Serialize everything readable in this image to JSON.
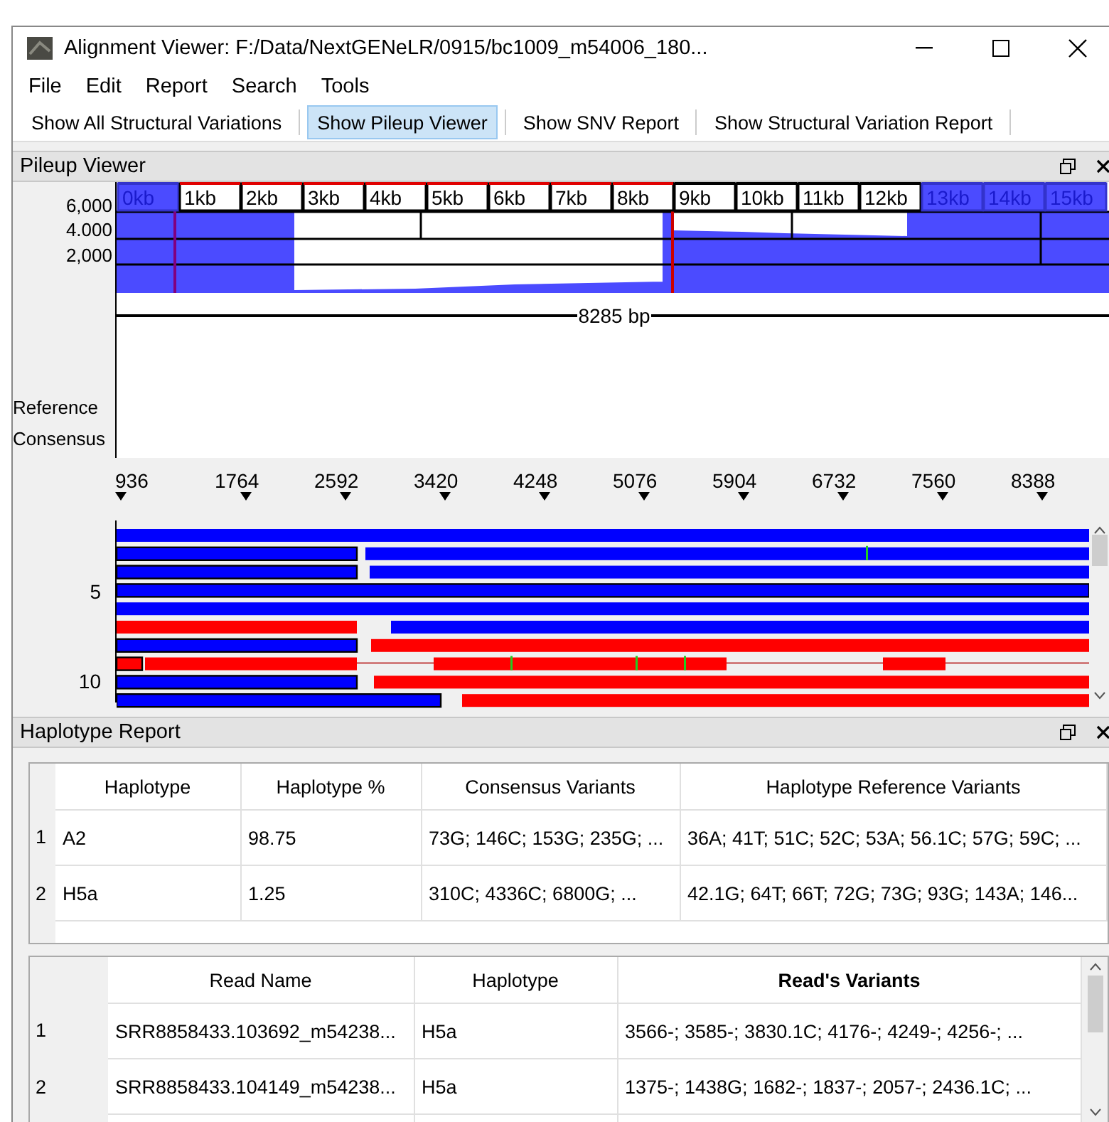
{
  "window": {
    "title": "Alignment Viewer: F:/Data/NextGENeLR/0915/bc1009_m54006_180..."
  },
  "menu": [
    "File",
    "Edit",
    "Report",
    "Search",
    "Tools"
  ],
  "toolbar": [
    {
      "label": "Show All Structural Variations",
      "selected": false
    },
    {
      "label": "Show Pileup Viewer",
      "selected": true
    },
    {
      "label": "Show SNV Report",
      "selected": false
    },
    {
      "label": "Show Structural Variation Report",
      "selected": false
    }
  ],
  "pileup": {
    "title": "Pileup Viewer",
    "kb_ticks": [
      {
        "label": "0kb",
        "kind": "outside"
      },
      {
        "label": "1kb",
        "kind": "range"
      },
      {
        "label": "2kb",
        "kind": "range"
      },
      {
        "label": "3kb",
        "kind": "range"
      },
      {
        "label": "4kb",
        "kind": "range"
      },
      {
        "label": "5kb",
        "kind": "range"
      },
      {
        "label": "6kb",
        "kind": "range"
      },
      {
        "label": "7kb",
        "kind": "range"
      },
      {
        "label": "8kb",
        "kind": "range"
      },
      {
        "label": "9kb",
        "kind": "plain"
      },
      {
        "label": "10kb",
        "kind": "plain"
      },
      {
        "label": "11kb",
        "kind": "plain"
      },
      {
        "label": "12kb",
        "kind": "plain"
      },
      {
        "label": "13kb",
        "kind": "outside"
      },
      {
        "label": "14kb",
        "kind": "outside"
      },
      {
        "label": "15kb",
        "kind": "outside"
      }
    ],
    "y_labels": [
      "6,000",
      "4.000",
      "2,000"
    ],
    "span_label": "8285 bp",
    "track_labels": [
      "Reference",
      "Consensus"
    ],
    "positions": [
      "936",
      "1764",
      "2592",
      "3420",
      "4248",
      "5076",
      "5904",
      "6732",
      "7560",
      "8388"
    ],
    "row_labels": [
      "5",
      "10"
    ]
  },
  "haplotype_report": {
    "title": "Haplotype Report",
    "columns": [
      "Haplotype",
      "Haplotype %",
      "Consensus Variants",
      "Haplotype Reference Variants"
    ],
    "rows": [
      {
        "index": "1",
        "cells": [
          "A2",
          "98.75",
          "73G; 146C; 153G; 235G; ...",
          "36A; 41T; 51C; 52C; 53A; 56.1C; 57G; 59C; ..."
        ]
      },
      {
        "index": "2",
        "cells": [
          "H5a",
          "1.25",
          "310C; 4336C; 6800G; ...",
          "42.1G; 64T; 66T; 72G; 73G; 93G; 143A; 146..."
        ]
      }
    ]
  },
  "reads_table": {
    "columns": [
      {
        "label": "Read Name",
        "sorted": false
      },
      {
        "label": "Haplotype",
        "sorted": false
      },
      {
        "label": "Read's Variants",
        "sorted": true
      }
    ],
    "rows": [
      {
        "index": "1",
        "cells": [
          "SRR8858433.103692_m54238...",
          "H5a",
          "3566-; 3585-; 3830.1C; 4176-; 4249-; 4256-; ..."
        ]
      },
      {
        "index": "2",
        "cells": [
          "SRR8858433.104149_m54238...",
          "H5a",
          "1375-; 1438G; 1682-; 1837-; 2057-; 2436.1C; ..."
        ]
      }
    ]
  }
}
